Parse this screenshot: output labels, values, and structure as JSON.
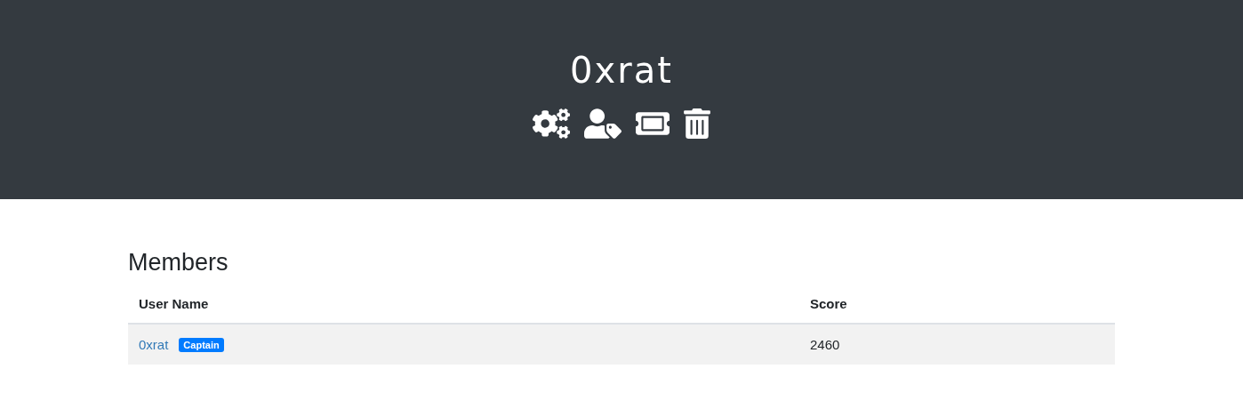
{
  "header": {
    "title": "0xrat",
    "actions": [
      {
        "kind": "settings"
      },
      {
        "kind": "user-tag"
      },
      {
        "kind": "ticket"
      },
      {
        "kind": "delete"
      }
    ]
  },
  "members": {
    "heading": "Members",
    "columns": [
      "User Name",
      "Score"
    ],
    "rows": [
      {
        "name": "0xrat",
        "badge": "Captain",
        "score": "2460"
      }
    ]
  }
}
